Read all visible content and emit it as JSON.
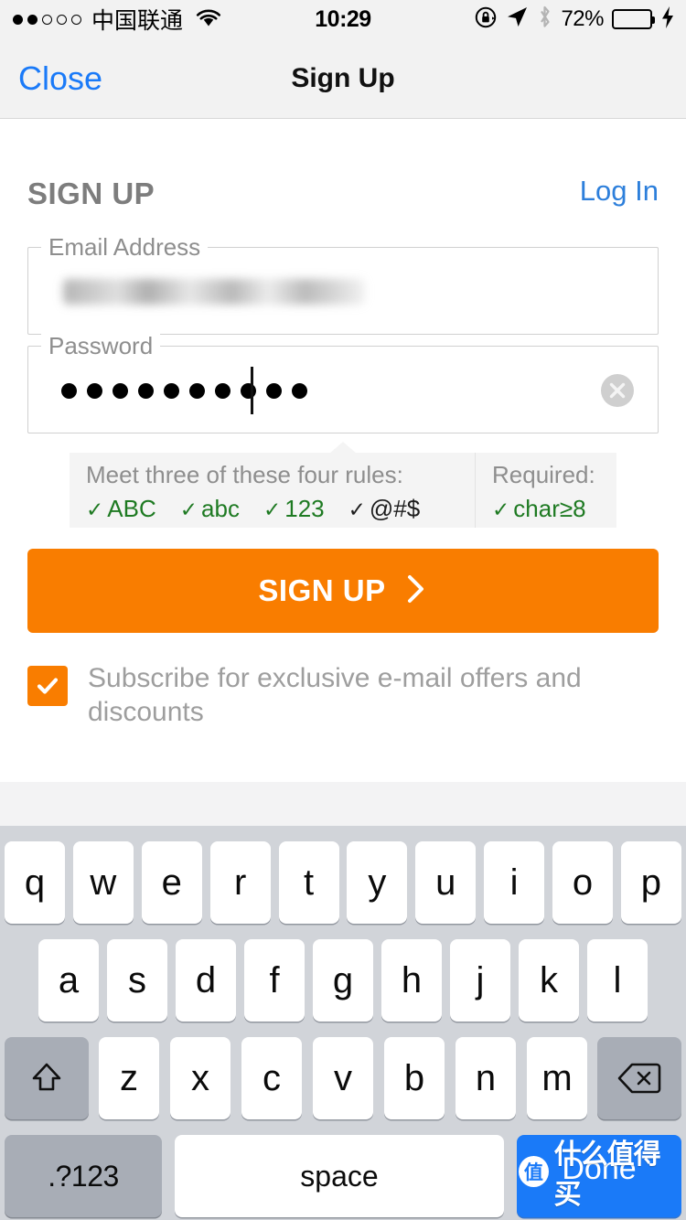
{
  "status_bar": {
    "signal_filled": 2,
    "signal_total": 5,
    "carrier": "中国联通",
    "wifi_icon": "wifi-icon",
    "time": "10:29",
    "rotation_lock_icon": "rotation-lock-icon",
    "location_icon": "location-arrow-icon",
    "bluetooth_icon": "bluetooth-icon",
    "battery_percent": "72%",
    "battery_level": 72,
    "battery_color": "#4cd964",
    "charging_icon": "lightning-bolt-icon"
  },
  "nav_bar": {
    "close_label": "Close",
    "title": "Sign Up",
    "close_color": "#1a7af8"
  },
  "form": {
    "heading": "SIGN UP",
    "login_link": "Log In",
    "login_link_color": "#2d7fdb",
    "email": {
      "label": "Email Address",
      "value": "",
      "placeholder": "Email Address",
      "redacted": true
    },
    "password": {
      "label": "Password",
      "value": "••••••••••",
      "dot_count": 10,
      "placeholder": "Password",
      "clear_icon": "clear-circle-icon"
    }
  },
  "password_rules": {
    "left_heading": "Meet three of these four rules:",
    "right_heading": "Required:",
    "left_rules": [
      {
        "label": "ABC",
        "met": true
      },
      {
        "label": "abc",
        "met": true
      },
      {
        "label": "123",
        "met": true
      },
      {
        "label": "@#$",
        "met": false
      }
    ],
    "right_rules": [
      {
        "label": "char≥8",
        "met": true
      }
    ],
    "check_glyph": "✓",
    "met_color": "#1e7a22",
    "unmet_color": "#1c1c1c",
    "background": "#f4f4f4"
  },
  "signup_button": {
    "label": "SIGN UP",
    "chevron_icon": "chevron-right-icon",
    "background": "#f97d00",
    "text_color": "#ffffff"
  },
  "subscribe": {
    "checked": true,
    "label": "Subscribe for exclusive e-mail offers and discounts",
    "check_icon": "checkmark-icon",
    "box_color": "#f97d00"
  },
  "keyboard": {
    "row1": [
      "q",
      "w",
      "e",
      "r",
      "t",
      "y",
      "u",
      "i",
      "o",
      "p"
    ],
    "row2": [
      "a",
      "s",
      "d",
      "f",
      "g",
      "h",
      "j",
      "k",
      "l"
    ],
    "row3": [
      "z",
      "x",
      "c",
      "v",
      "b",
      "n",
      "m"
    ],
    "shift_icon": "shift-arrow-icon",
    "delete_icon": "backspace-icon",
    "numeric_label": ".?123",
    "space_label": "space",
    "done_label": "Done",
    "done_color": "#1a7af8"
  },
  "watermark": {
    "badge": "值",
    "text": "什么值得买"
  }
}
